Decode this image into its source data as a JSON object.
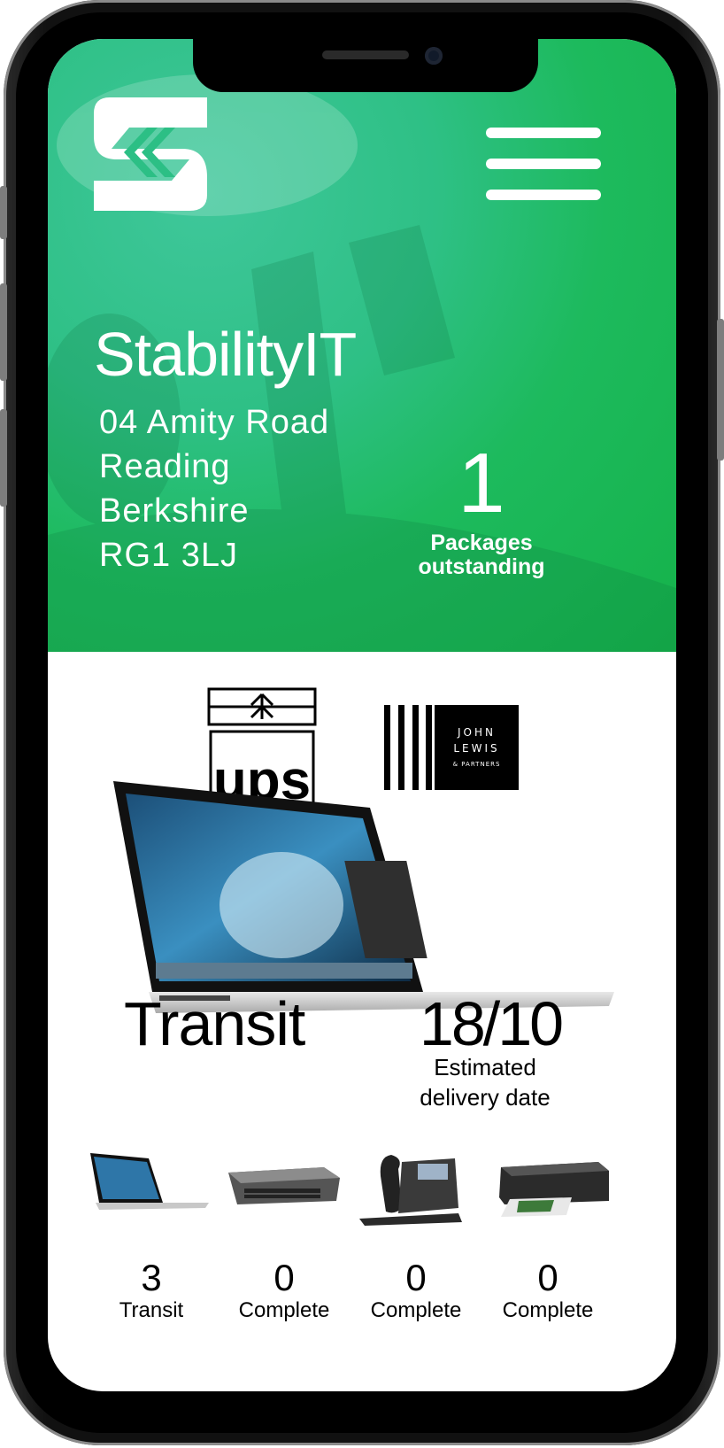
{
  "colors": {
    "hero_green": "#1dba5d",
    "text_light": "#ffffff",
    "text_dark": "#000000"
  },
  "header": {
    "logo_icon": "stabilityit-logo",
    "menu_icon": "hamburger-menu-icon"
  },
  "company": {
    "name": "StabilityIT",
    "address": [
      "04 Amity Road",
      "Reading",
      "Berkshire",
      "RG1 3LJ"
    ]
  },
  "packages": {
    "count": "1",
    "label_line1": "Packages",
    "label_line2": "outstanding"
  },
  "shipment": {
    "carrier": "ups",
    "retailer": {
      "line1": "JOHN",
      "line2": "LEWIS",
      "line3": "& PARTNERS"
    },
    "status": "Transit",
    "date": "18/10",
    "date_label_line1": "Estimated",
    "date_label_line2": "delivery date"
  },
  "summary": [
    {
      "item": "laptop",
      "count": "3",
      "label": "Transit"
    },
    {
      "item": "network-switch",
      "count": "0",
      "label": "Complete"
    },
    {
      "item": "desk-phone",
      "count": "0",
      "label": "Complete"
    },
    {
      "item": "printer",
      "count": "0",
      "label": "Complete"
    }
  ]
}
